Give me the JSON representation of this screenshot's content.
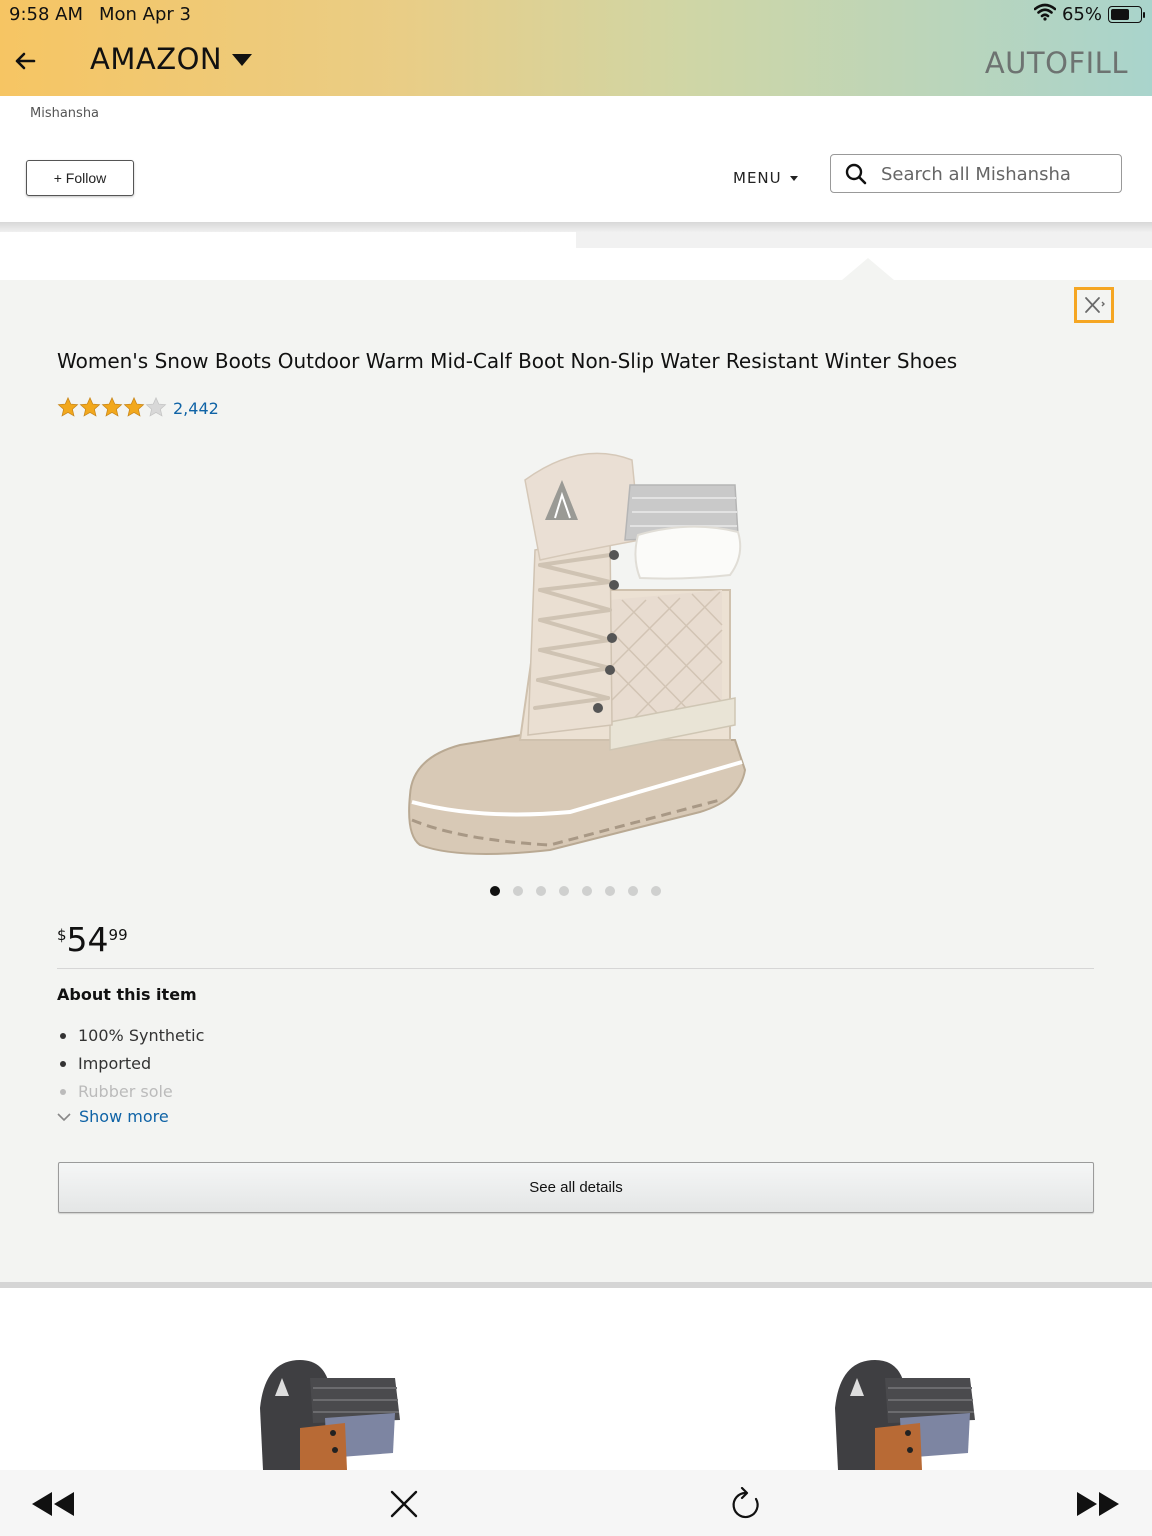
{
  "status_bar": {
    "time": "9:58 AM",
    "date": "Mon Apr 3",
    "battery": "65%",
    "battery_level": 0.65
  },
  "app_bar": {
    "title": "AMAZON",
    "autofill": "AUTOFILL"
  },
  "store": {
    "name": "Mishansha",
    "follow_label": "+ Follow",
    "menu_label": "MENU",
    "search_placeholder": "Search all Mishansha"
  },
  "product": {
    "title": "Women's Snow Boots Outdoor Warm Mid-Calf Boot Non-Slip Water Resistant Winter Shoes",
    "rating": 4.0,
    "review_count": "2,442",
    "image_count": 8,
    "active_image": 0,
    "price_symbol": "$",
    "price_whole": "54",
    "price_fraction": "99",
    "about_heading": "About this item",
    "bullets": [
      "100% Synthetic",
      "Imported",
      "Rubber sole"
    ],
    "show_more": "Show more",
    "details_button": "See all details"
  },
  "colors": {
    "accent_link": "#0f63a6",
    "star": "#f2a81d",
    "close_highlight": "#f5a623"
  }
}
